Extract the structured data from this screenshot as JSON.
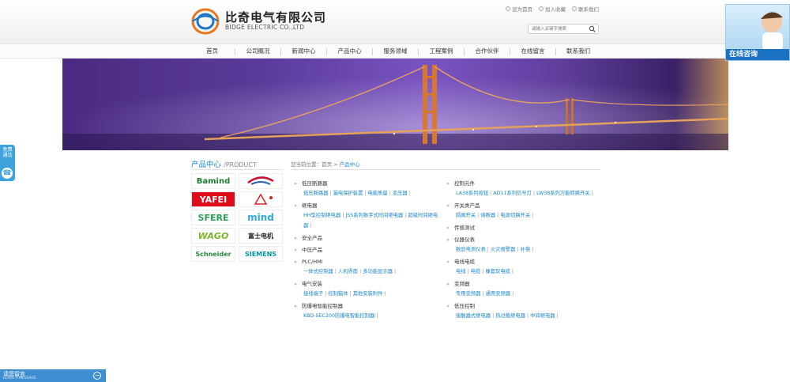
{
  "header": {
    "company_cn": "比奇电气有限公司",
    "company_en": "BIDGE ELECTRIC CO.,LTD",
    "top_links": [
      {
        "label": "设为首页",
        "icon": "home-icon"
      },
      {
        "label": "加入收藏",
        "icon": "star-icon"
      },
      {
        "label": "联系我们",
        "icon": "mail-icon"
      }
    ],
    "search_placeholder": "请输入关键字搜索"
  },
  "nav": {
    "items": [
      "首页",
      "公司概况",
      "新闻中心",
      "产品中心",
      "服务领域",
      "工程案例",
      "合作伙伴",
      "在线留言",
      "联系我们"
    ]
  },
  "sidebar": {
    "title_cn": "产品中心",
    "title_en": "/PRODUCT",
    "brands": [
      "Bamind",
      "",
      "YAFEI",
      "",
      "SFERE",
      "mind",
      "WAGO",
      "富士电机",
      "Schneider",
      "SIEMENS"
    ]
  },
  "breadcrumb": {
    "prefix": "您当前位置：",
    "home": "首页",
    "sep": " > ",
    "current": "产品中心"
  },
  "categories_left": [
    {
      "title": "低压断路器",
      "subs": [
        "低压断路器",
        "漏电保护装置",
        "电能质量",
        "变压器"
      ]
    },
    {
      "title": "继电器",
      "subs": [
        "HH型控制继电器",
        "JSS系列数字式时间继电器",
        "超级时间继电器"
      ]
    },
    {
      "title": "安全产品",
      "subs": []
    },
    {
      "title": "中压产品",
      "subs": []
    },
    {
      "title": "PLC/HMI",
      "subs": [
        "一体式控制器",
        "人机界面",
        "多功能显示器"
      ]
    },
    {
      "title": "电气安装",
      "subs": [
        "接线端子",
        "控制箱体",
        "其他安装附件"
      ]
    },
    {
      "title": "防爆电智能控制器",
      "subs": [
        "KBD-SEC200防爆电智能控制器"
      ]
    }
  ],
  "categories_right": [
    {
      "title": "控制元件",
      "subs": [
        "LA38系列按钮",
        "AD11系列信号灯",
        "LW38系列万能转换开关"
      ]
    },
    {
      "title": "开关类产品",
      "subs": [
        "隔离开关",
        "熔断器",
        "电源切换开关"
      ]
    },
    {
      "title": "传感测试",
      "subs": []
    },
    {
      "title": "仪器仪表",
      "subs": [
        "数显电测仪表",
        "火灾报警器",
        "补偿"
      ]
    },
    {
      "title": "电线电缆",
      "subs": [
        "电线",
        "电缆",
        "橡套软电缆"
      ]
    },
    {
      "title": "变频器",
      "subs": [
        "专用变频器",
        "通用变频器"
      ]
    },
    {
      "title": "低压控制",
      "subs": [
        "接触器式继电器",
        "热过载继电器",
        "中间继电器"
      ]
    }
  ],
  "floaters": {
    "online_consult": "在线咨询",
    "free_call": "免费通话",
    "message_title": "请您留言",
    "message_sub": "LEAVE A MESSAGE",
    "message_toggle": "−"
  },
  "colors": {
    "accent": "#1a87c9",
    "brand_orange": "#e8771d",
    "bar_blue": "#3d8fd1"
  }
}
